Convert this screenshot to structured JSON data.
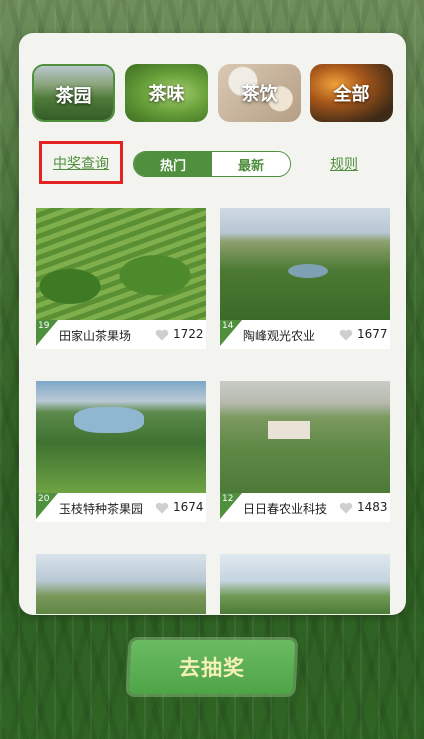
{
  "categories": [
    {
      "label": "茶园",
      "active": true
    },
    {
      "label": "茶味",
      "active": false
    },
    {
      "label": "茶饮",
      "active": false
    },
    {
      "label": "全部",
      "active": false
    }
  ],
  "controls": {
    "winner_query": "中奖查询",
    "tab_hot": "热门",
    "tab_new": "最新",
    "rules": "规则"
  },
  "cards": [
    {
      "rank": "19",
      "name": "田家山茶果场",
      "likes": "1722"
    },
    {
      "rank": "14",
      "name": "陶峰观光农业",
      "likes": "1677"
    },
    {
      "rank": "20",
      "name": "玉枝特种茶果园",
      "likes": "1674"
    },
    {
      "rank": "12",
      "name": "日日春农业科技",
      "likes": "1483"
    }
  ],
  "draw_button": "去抽奖",
  "colors": {
    "accent": "#4f8f3d",
    "highlight_border": "#e52222",
    "button": "#5aae52"
  }
}
